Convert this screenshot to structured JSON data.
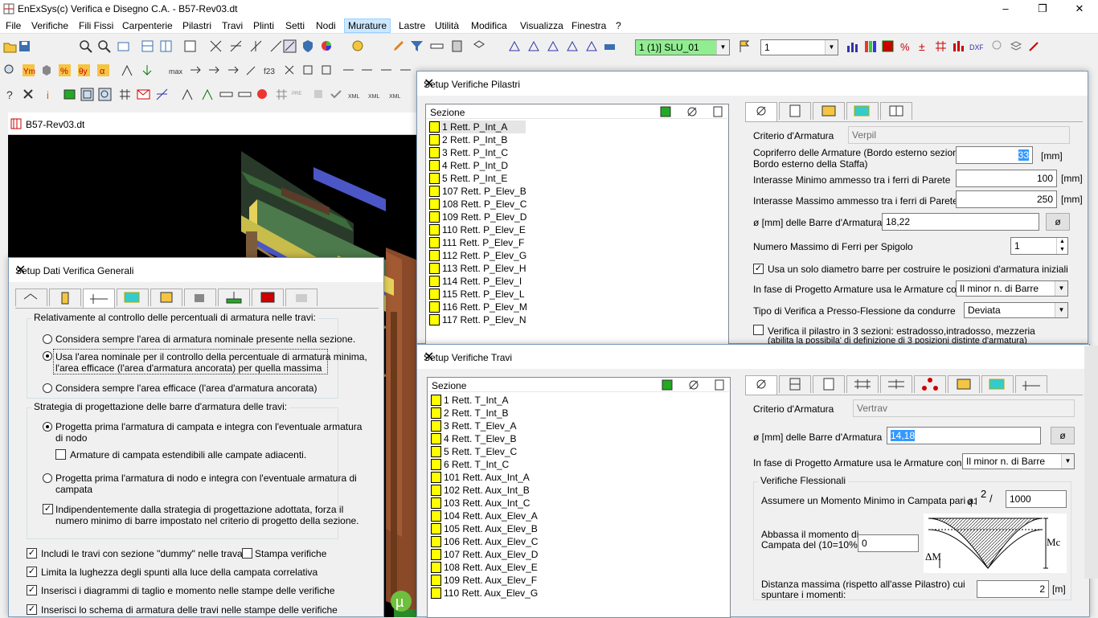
{
  "app": {
    "title": "EnExSys(c) Verifica e Disegno C.A. - B57-Rev03.dt",
    "window_controls": [
      "–",
      "❐",
      "✕"
    ]
  },
  "menu": [
    "File",
    "Verifiche",
    "Fili Fissi",
    "Carpenterie",
    "Pilastri",
    "Travi",
    "Plinti",
    "Setti",
    "Nodi",
    "Murature",
    "Lastre",
    "Utilità",
    "Modifica",
    "Visualizza",
    "Finestra",
    "?"
  ],
  "toolbar": {
    "combination_combo": "1 (1)] SLU_01",
    "number_combo": "1",
    "combo_color": "#90ee90"
  },
  "document": {
    "title": "B57-Rev03.dt"
  },
  "generali": {
    "title": "Setup Dati Verifica Generali",
    "group1_title": "Relativamente al controllo delle percentuali di armatura nelle travi:",
    "radio1": "Considera sempre l'area di armatura nominale presente nella sezione.",
    "radio2_l1": "Usa l'area nominale per il controllo della percentuale di armatura minima,",
    "radio2_l2": "l'area efficace (l'area d'armatura ancorata) per quella massima",
    "radio3": "Considera sempre l'area efficace (l'area d'armatura ancorata)",
    "group2_title": "Strategia di progettazione delle barre d'armatura delle travi:",
    "radio4_l1": "Progetta prima l'armatura di campata e integra con l'eventuale armatura",
    "radio4_l2": "di nodo",
    "check1": "Armature di campata estendibili alle campate adiacenti.",
    "radio5_l1": "Progetta prima l'armatura di nodo e integra con l'eventuale armatura di",
    "radio5_l2": "campata",
    "check2_l1": "Indipendentemente dalla strategia di progettazione adottata, forza il",
    "check2_l2": "numero  minimo di barre impostato nel criterio di progetto della sezione.",
    "check3": "Includi le travi con sezione \"dummy\" nelle travate",
    "check4": "Stampa verifiche",
    "check5": "Limita la lughezza degli spunti alla luce della campata correlativa",
    "check6": "Inserisci i diagrammi di taglio e momento nelle stampe delle verifiche",
    "check7": "Inserisci lo schema di armatura delle travi nelle stampe delle verifiche"
  },
  "pilastri": {
    "title": "Setup Verifiche Pilastri",
    "list_header": "Sezione",
    "items": [
      "1 Rett.  P_Int_A",
      "2 Rett.  P_Int_B",
      "3 Rett.  P_Int_C",
      "4 Rett.  P_Int_D",
      "5 Rett.  P_Int_E",
      "107 Rett.  P_Elev_B",
      "108 Rett.  P_Elev_C",
      "109 Rett.  P_Elev_D",
      "110 Rett.  P_Elev_E",
      "111 Rett.  P_Elev_F",
      "112 Rett.  P_Elev_G",
      "113 Rett.  P_Elev_H",
      "114 Rett.  P_Elev_I",
      "115 Rett.  P_Elev_L",
      "116 Rett.  P_Elev_M",
      "117 Rett.  P_Elev_N"
    ],
    "criterio_label": "Criterio d'Armatura",
    "criterio_value": "Verpil",
    "copriferro_label_l1": "Copriferro delle Armature (Bordo esterno sezione /",
    "copriferro_label_l2": "Bordo esterno della Staffa)",
    "copriferro_value": "33",
    "unit_mm": "[mm]",
    "interasse_min_label": "Interasse Minimo ammesso tra i ferri di Parete",
    "interasse_min_value": "100",
    "interasse_max_label": "Interasse Massimo ammesso tra i ferri di Parete",
    "interasse_max_value": "250",
    "diametri_label": "ø [mm] delle Barre d'Armatura",
    "diametri_value": "18,22",
    "diam_button": "ø",
    "nmax_label": "Numero Massimo di Ferri per Spigolo",
    "nmax_value": "1",
    "unico_diam": "Usa un solo diametro barre per costruire le posizioni d'armatura iniziali",
    "fase_label": "In fase di Progetto Armature usa le Armature con:",
    "fase_value": "Il minor n. di Barre",
    "tipo_label": "Tipo di Verifica a Presso-Flessione da condurre",
    "tipo_value": "Deviata",
    "tre_sez_l1": "Verifica il pilastro in 3 sezioni: estradosso,intradosso, mezzeria",
    "tre_sez_l2": "(abilita la possibila' di  definizione di 3 posizioni distinte d'armatura)"
  },
  "travi": {
    "title": "Setup Verifiche Travi",
    "list_header": "Sezione",
    "items": [
      "1 Rett.  T_Int_A",
      "2 Rett.  T_Int_B",
      "3 Rett.  T_Elev_A",
      "4 Rett.  T_Elev_B",
      "5 Rett.  T_Elev_C",
      "6 Rett.  T_Int_C",
      "101 Rett.  Aux_Int_A",
      "102 Rett.  Aux_Int_B",
      "103 Rett.  Aux_Int_C",
      "104 Rett.  Aux_Elev_A",
      "105 Rett.  Aux_Elev_B",
      "106 Rett.  Aux_Elev_C",
      "107 Rett.  Aux_Elev_D",
      "108 Rett.  Aux_Elev_E",
      "109 Rett.  Aux_Elev_F",
      "110 Rett.  Aux_Elev_G"
    ],
    "criterio_label": "Criterio d'Armatura",
    "criterio_value": "Vertrav",
    "diametri_label": "ø [mm] delle Barre d'Armatura",
    "diametri_value": "14,18",
    "diam_button": "ø",
    "fase_label": "In fase di Progetto Armature usa le Armature con:",
    "fase_value": "Il minor n. di Barre",
    "group_title": "Verifiche Flessionali",
    "momento_label": "Assumere un Momento Minimo in Campata pari a:",
    "momento_formula_a": "q l",
    "momento_formula_exp": "2",
    "momento_formula_b": "/",
    "momento_value": "1000",
    "abbassa_l1": "Abbassa il momento di",
    "abbassa_l2": "Campata del (10=10%):",
    "abbassa_value": "0",
    "diag_mc": "Mc",
    "diag_dm": "ΔM",
    "distanza_l1": "Distanza massima (rispetto all'asse Pilastro) cui",
    "distanza_l2": "spuntare i momenti:",
    "distanza_value": "2",
    "unit_m": "[m]"
  }
}
